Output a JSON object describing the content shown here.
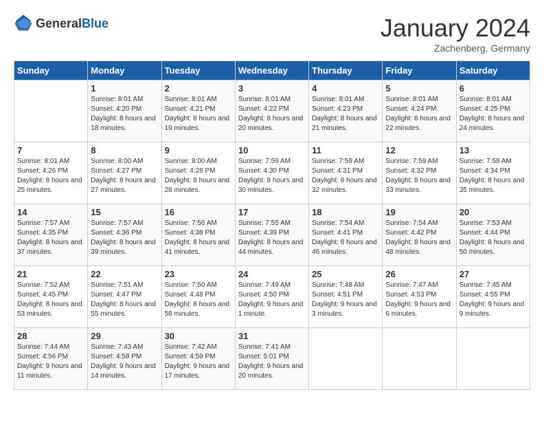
{
  "header": {
    "logo_general": "General",
    "logo_blue": "Blue",
    "month": "January 2024",
    "location": "Zachenberg, Germany"
  },
  "weekdays": [
    "Sunday",
    "Monday",
    "Tuesday",
    "Wednesday",
    "Thursday",
    "Friday",
    "Saturday"
  ],
  "weeks": [
    [
      {
        "day": "",
        "sunrise": "",
        "sunset": "",
        "daylight": ""
      },
      {
        "day": "1",
        "sunrise": "Sunrise: 8:01 AM",
        "sunset": "Sunset: 4:20 PM",
        "daylight": "Daylight: 8 hours and 18 minutes."
      },
      {
        "day": "2",
        "sunrise": "Sunrise: 8:01 AM",
        "sunset": "Sunset: 4:21 PM",
        "daylight": "Daylight: 8 hours and 19 minutes."
      },
      {
        "day": "3",
        "sunrise": "Sunrise: 8:01 AM",
        "sunset": "Sunset: 4:22 PM",
        "daylight": "Daylight: 8 hours and 20 minutes."
      },
      {
        "day": "4",
        "sunrise": "Sunrise: 8:01 AM",
        "sunset": "Sunset: 4:23 PM",
        "daylight": "Daylight: 8 hours and 21 minutes."
      },
      {
        "day": "5",
        "sunrise": "Sunrise: 8:01 AM",
        "sunset": "Sunset: 4:24 PM",
        "daylight": "Daylight: 8 hours and 22 minutes."
      },
      {
        "day": "6",
        "sunrise": "Sunrise: 8:01 AM",
        "sunset": "Sunset: 4:25 PM",
        "daylight": "Daylight: 8 hours and 24 minutes."
      }
    ],
    [
      {
        "day": "7",
        "sunrise": "Sunrise: 8:01 AM",
        "sunset": "Sunset: 4:26 PM",
        "daylight": "Daylight: 8 hours and 25 minutes."
      },
      {
        "day": "8",
        "sunrise": "Sunrise: 8:00 AM",
        "sunset": "Sunset: 4:27 PM",
        "daylight": "Daylight: 8 hours and 27 minutes."
      },
      {
        "day": "9",
        "sunrise": "Sunrise: 8:00 AM",
        "sunset": "Sunset: 4:28 PM",
        "daylight": "Daylight: 8 hours and 28 minutes."
      },
      {
        "day": "10",
        "sunrise": "Sunrise: 7:59 AM",
        "sunset": "Sunset: 4:30 PM",
        "daylight": "Daylight: 8 hours and 30 minutes."
      },
      {
        "day": "11",
        "sunrise": "Sunrise: 7:59 AM",
        "sunset": "Sunset: 4:31 PM",
        "daylight": "Daylight: 8 hours and 32 minutes."
      },
      {
        "day": "12",
        "sunrise": "Sunrise: 7:59 AM",
        "sunset": "Sunset: 4:32 PM",
        "daylight": "Daylight: 8 hours and 33 minutes."
      },
      {
        "day": "13",
        "sunrise": "Sunrise: 7:58 AM",
        "sunset": "Sunset: 4:34 PM",
        "daylight": "Daylight: 8 hours and 35 minutes."
      }
    ],
    [
      {
        "day": "14",
        "sunrise": "Sunrise: 7:57 AM",
        "sunset": "Sunset: 4:35 PM",
        "daylight": "Daylight: 8 hours and 37 minutes."
      },
      {
        "day": "15",
        "sunrise": "Sunrise: 7:57 AM",
        "sunset": "Sunset: 4:36 PM",
        "daylight": "Daylight: 8 hours and 39 minutes."
      },
      {
        "day": "16",
        "sunrise": "Sunrise: 7:56 AM",
        "sunset": "Sunset: 4:38 PM",
        "daylight": "Daylight: 8 hours and 41 minutes."
      },
      {
        "day": "17",
        "sunrise": "Sunrise: 7:55 AM",
        "sunset": "Sunset: 4:39 PM",
        "daylight": "Daylight: 8 hours and 44 minutes."
      },
      {
        "day": "18",
        "sunrise": "Sunrise: 7:54 AM",
        "sunset": "Sunset: 4:41 PM",
        "daylight": "Daylight: 8 hours and 46 minutes."
      },
      {
        "day": "19",
        "sunrise": "Sunrise: 7:54 AM",
        "sunset": "Sunset: 4:42 PM",
        "daylight": "Daylight: 8 hours and 48 minutes."
      },
      {
        "day": "20",
        "sunrise": "Sunrise: 7:53 AM",
        "sunset": "Sunset: 4:44 PM",
        "daylight": "Daylight: 8 hours and 50 minutes."
      }
    ],
    [
      {
        "day": "21",
        "sunrise": "Sunrise: 7:52 AM",
        "sunset": "Sunset: 4:45 PM",
        "daylight": "Daylight: 8 hours and 53 minutes."
      },
      {
        "day": "22",
        "sunrise": "Sunrise: 7:51 AM",
        "sunset": "Sunset: 4:47 PM",
        "daylight": "Daylight: 8 hours and 55 minutes."
      },
      {
        "day": "23",
        "sunrise": "Sunrise: 7:50 AM",
        "sunset": "Sunset: 4:48 PM",
        "daylight": "Daylight: 8 hours and 58 minutes."
      },
      {
        "day": "24",
        "sunrise": "Sunrise: 7:49 AM",
        "sunset": "Sunset: 4:50 PM",
        "daylight": "Daylight: 9 hours and 1 minute."
      },
      {
        "day": "25",
        "sunrise": "Sunrise: 7:48 AM",
        "sunset": "Sunset: 4:51 PM",
        "daylight": "Daylight: 9 hours and 3 minutes."
      },
      {
        "day": "26",
        "sunrise": "Sunrise: 7:47 AM",
        "sunset": "Sunset: 4:53 PM",
        "daylight": "Daylight: 9 hours and 6 minutes."
      },
      {
        "day": "27",
        "sunrise": "Sunrise: 7:45 AM",
        "sunset": "Sunset: 4:55 PM",
        "daylight": "Daylight: 9 hours and 9 minutes."
      }
    ],
    [
      {
        "day": "28",
        "sunrise": "Sunrise: 7:44 AM",
        "sunset": "Sunset: 4:56 PM",
        "daylight": "Daylight: 9 hours and 11 minutes."
      },
      {
        "day": "29",
        "sunrise": "Sunrise: 7:43 AM",
        "sunset": "Sunset: 4:58 PM",
        "daylight": "Daylight: 9 hours and 14 minutes."
      },
      {
        "day": "30",
        "sunrise": "Sunrise: 7:42 AM",
        "sunset": "Sunset: 4:59 PM",
        "daylight": "Daylight: 9 hours and 17 minutes."
      },
      {
        "day": "31",
        "sunrise": "Sunrise: 7:41 AM",
        "sunset": "Sunset: 5:01 PM",
        "daylight": "Daylight: 9 hours and 20 minutes."
      },
      {
        "day": "",
        "sunrise": "",
        "sunset": "",
        "daylight": ""
      },
      {
        "day": "",
        "sunrise": "",
        "sunset": "",
        "daylight": ""
      },
      {
        "day": "",
        "sunrise": "",
        "sunset": "",
        "daylight": ""
      }
    ]
  ]
}
